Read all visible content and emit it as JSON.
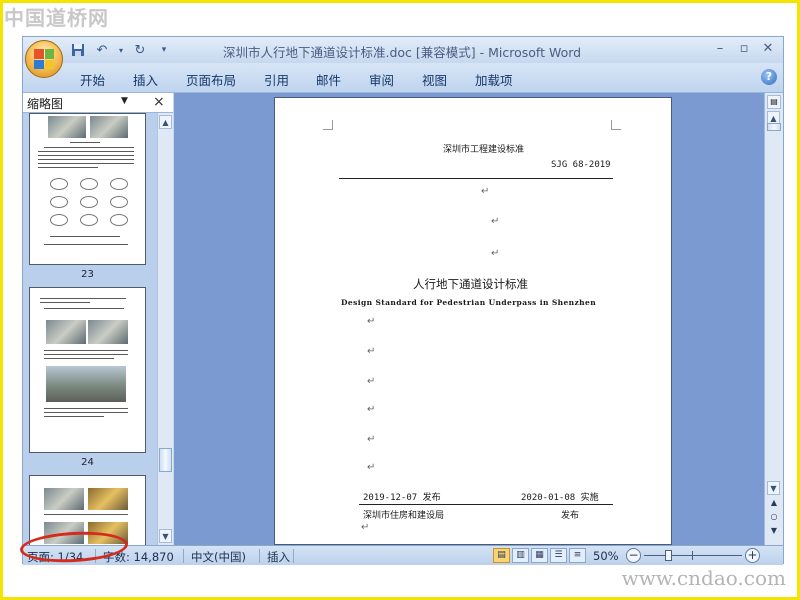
{
  "watermark": {
    "site_logo": "中国道桥网",
    "site_url": "www.cndao.com"
  },
  "app": {
    "window_title": "深圳市人行地下通道设计标准.doc [兼容模式] - Microsoft Word",
    "ribbon_tabs": [
      "开始",
      "插入",
      "页面布局",
      "引用",
      "邮件",
      "审阅",
      "视图",
      "加载项"
    ],
    "help_label": "?"
  },
  "thumbnail_pane": {
    "title": "缩略图",
    "close_label": "×",
    "page_numbers": [
      "23",
      "24"
    ]
  },
  "document": {
    "header_org": "深圳市工程建设标准",
    "code": "SJG 68-2019",
    "title_cn": "人行地下通道设计标准",
    "title_en": "Design Standard for Pedestrian Underpass in Shenzhen",
    "issue_date": "2019-12-07 发布",
    "implement_date": "2020-01-08 实施",
    "issuer": "深圳市住房和建设局",
    "issue_word": "发布",
    "para_mark": "↵"
  },
  "status_bar": {
    "page": "页面: 1/34",
    "words": "字数: 14,870",
    "language": "中文(中国)",
    "mode": "插入",
    "zoom": "50%",
    "zoom_level": 0.5
  },
  "colors": {
    "ribbon": "#c5d9f1",
    "doc_background": "#7a9ad1",
    "highlight": "#d62a1c",
    "frame": "#f5e400"
  }
}
